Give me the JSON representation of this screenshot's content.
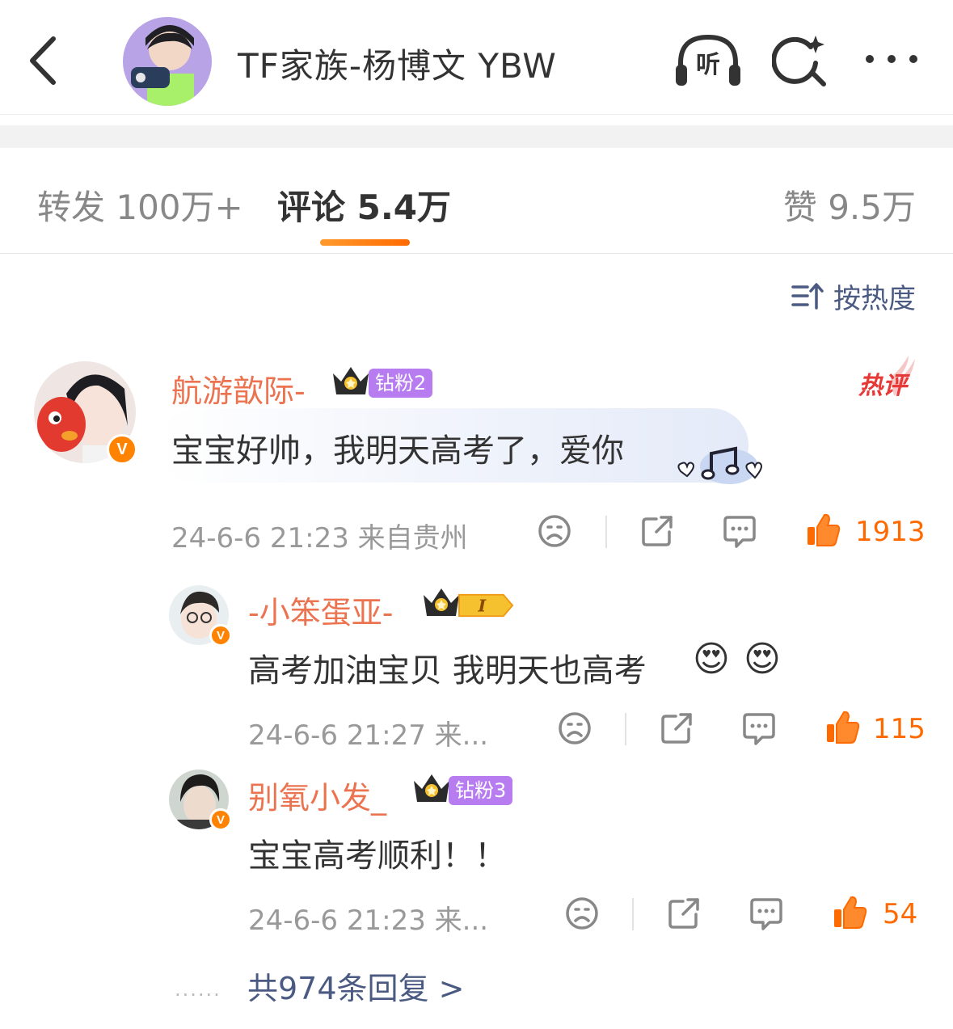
{
  "header": {
    "back_icon": "chevron-left-icon",
    "title": "TF家族-杨博文 YBW",
    "listen_label": "听",
    "search_icon": "search-sparkle-icon",
    "more_icon": "more-dots-icon"
  },
  "tabs": {
    "repost": "转发 100万+",
    "comment": "评论 5.4万",
    "like": "赞 9.5万",
    "active": "comment"
  },
  "sort": {
    "label": "按热度",
    "icon": "sort-icon"
  },
  "colors": {
    "accent": "#ff8200",
    "username": "#eb7350",
    "link": "#4a5a82",
    "like": "#ff6a00",
    "fan_badge": "#b77cf0"
  },
  "comments": [
    {
      "user": "航游歆际-",
      "fan_badge": "钻粉2",
      "hot_tag": "热评",
      "text": "宝宝好帅，我明天高考了，爱你",
      "meta": "24-6-6 21:23  来自贵州",
      "likes": "1913",
      "verified_mark": "V"
    }
  ],
  "replies": [
    {
      "user": "-小笨蛋亚-",
      "level_badge": "I",
      "text": "高考加油宝贝 我明天也高考",
      "emoji": [
        "😍",
        "😍"
      ],
      "meta": "24-6-6 21:27  来...",
      "likes": "115",
      "verified_mark": "V"
    },
    {
      "user": "别氧小发_",
      "fan_badge": "钻粉3",
      "text": "宝宝高考顺利！！",
      "meta": "24-6-6 21:23  来...",
      "likes": "54",
      "verified_mark": "V"
    }
  ],
  "more_replies": {
    "dots": "......",
    "label": "共974条回复 >"
  }
}
